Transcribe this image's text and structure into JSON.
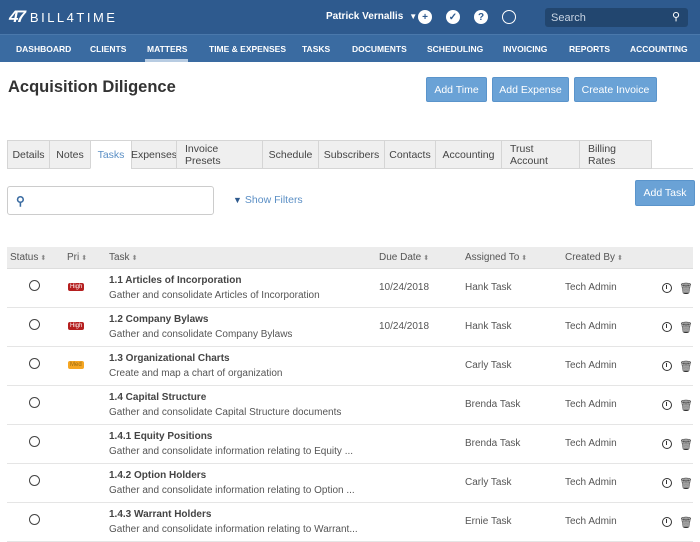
{
  "app": {
    "logo_mark": "47",
    "logo_text": "BILL4TIME",
    "user_name": "Patrick Vernallis",
    "search_placeholder": "Search",
    "icons": [
      "plus-circle-icon",
      "check-circle-icon",
      "help-circle-icon",
      "clock-icon",
      "search-icon"
    ]
  },
  "nav": {
    "items": [
      "DASHBOARD",
      "CLIENTS",
      "MATTERS",
      "TIME & EXPENSES",
      "TASKS",
      "DOCUMENTS",
      "SCHEDULING",
      "INVOICING",
      "REPORTS",
      "ACCOUNTING"
    ],
    "active": "MATTERS"
  },
  "page": {
    "title": "Acquisition Diligence",
    "buttons": {
      "add_time": "Add Time",
      "add_expense": "Add Expense",
      "create_invoice": "Create Invoice",
      "add_task": "Add Task"
    }
  },
  "tabs": {
    "items": [
      "Details",
      "Notes",
      "Tasks",
      "Expenses",
      "Invoice Presets",
      "Schedule",
      "Subscribers",
      "Contacts",
      "Accounting",
      "Trust Account",
      "Billing Rates"
    ],
    "active": "Tasks"
  },
  "filters": {
    "search_value": "",
    "show_filters_label": "Show Filters"
  },
  "table": {
    "columns": [
      "Status",
      "Pri",
      "Task",
      "Due Date",
      "Assigned To",
      "Created By"
    ],
    "sort_glyph": "⬍",
    "rows": [
      {
        "priority": "High",
        "title": "1.1 Articles of Incorporation",
        "desc": "Gather and consolidate Articles of Incorporation",
        "due": "10/24/2018",
        "assigned": "Hank Task",
        "created": "Tech Admin"
      },
      {
        "priority": "High",
        "title": "1.2 Company Bylaws",
        "desc": "Gather and consolidate Company Bylaws",
        "due": "10/24/2018",
        "assigned": "Hank Task",
        "created": "Tech Admin"
      },
      {
        "priority": "Med",
        "title": "1.3 Organizational Charts",
        "desc": "Create and map a chart of organization",
        "due": "",
        "assigned": "Carly Task",
        "created": "Tech Admin"
      },
      {
        "priority": "",
        "title": "1.4 Capital Structure",
        "desc": "Gather and consolidate Capital Structure documents",
        "due": "",
        "assigned": "Brenda Task",
        "created": "Tech Admin"
      },
      {
        "priority": "",
        "title": "1.4.1 Equity Positions",
        "desc": "Gather and consolidate information relating to Equity ...",
        "due": "",
        "assigned": "Brenda Task",
        "created": "Tech Admin"
      },
      {
        "priority": "",
        "title": "1.4.2 Option Holders",
        "desc": "Gather and consolidate information relating to Option ...",
        "due": "",
        "assigned": "Carly Task",
        "created": "Tech Admin"
      },
      {
        "priority": "",
        "title": "1.4.3 Warrant Holders",
        "desc": "Gather and consolidate information relating to Warrant...",
        "due": "",
        "assigned": "Ernie Task",
        "created": "Tech Admin"
      }
    ]
  },
  "colors": {
    "topbar": "#2e5a8e",
    "navbar": "#3a6ba1",
    "button": "#6aa2d6",
    "high_badge": "#b51f1f",
    "med_badge": "#f5a623",
    "link": "#5b8fc5"
  }
}
